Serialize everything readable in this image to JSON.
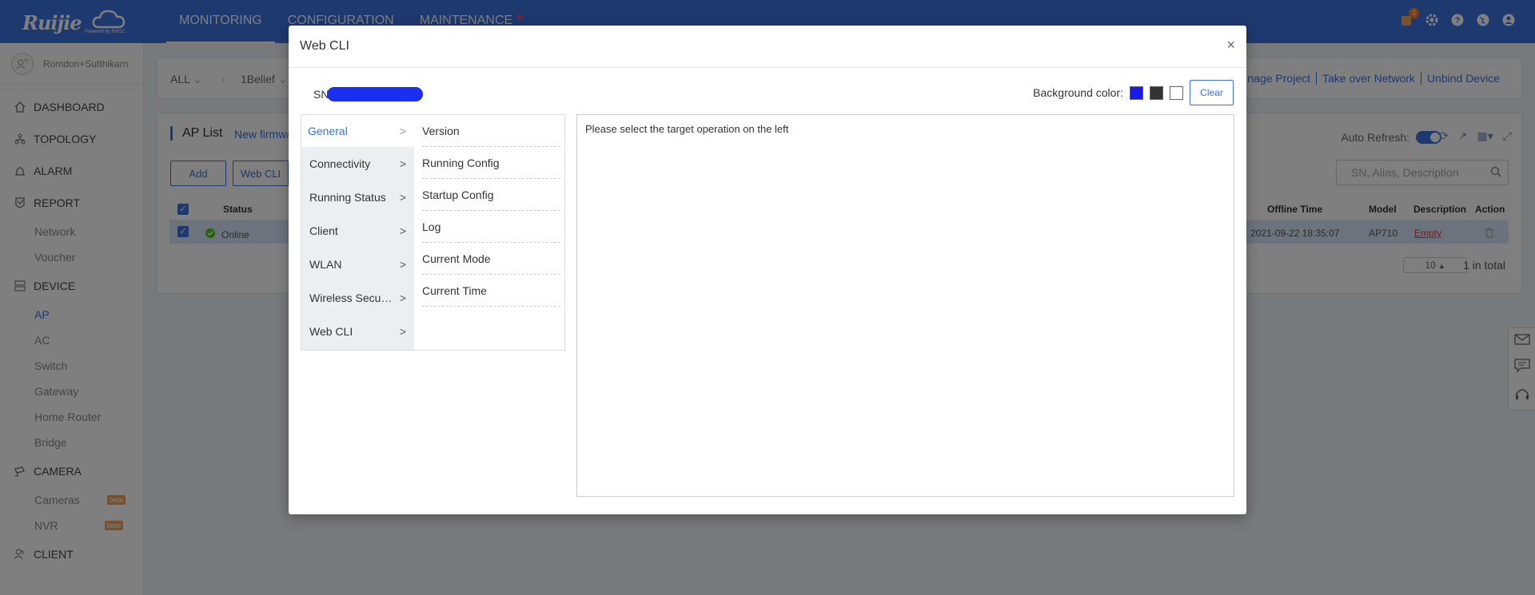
{
  "app": {
    "logo": "Ruijie",
    "logo_sub": "Powered by RACC"
  },
  "nav": {
    "items": [
      {
        "label": "MONITORING"
      },
      {
        "label": "CONFIGURATION"
      },
      {
        "label": "MAINTENANCE"
      }
    ],
    "notification_count": "2"
  },
  "sidebar": {
    "user": "Romdon+Sutthikarn",
    "items": [
      {
        "label": "DASHBOARD",
        "icon": "home-icon"
      },
      {
        "label": "TOPOLOGY",
        "icon": "topology-icon"
      },
      {
        "label": "ALARM",
        "icon": "alarm-icon"
      },
      {
        "label": "REPORT",
        "icon": "report-icon"
      },
      {
        "label": "DEVICE",
        "icon": "device-icon"
      },
      {
        "label": "CAMERA",
        "icon": "camera-icon"
      },
      {
        "label": "CLIENT",
        "icon": "client-icon"
      }
    ],
    "report_sub": [
      "Network",
      "Voucher"
    ],
    "device_sub": [
      "AP",
      "AC",
      "Switch",
      "Gateway",
      "Home Router",
      "Bridge"
    ],
    "camera_sub": [
      "Cameras",
      "NVR"
    ],
    "beta": "beta"
  },
  "breadcrumb": {
    "all": "ALL",
    "project": "1Belief",
    "links": [
      "nage Project",
      "Take over Network",
      "Unbind Device"
    ]
  },
  "ap_list": {
    "title": "AP List",
    "link": "New firmwa",
    "add_label": "Add",
    "webcli_label": "Web CLI",
    "auto_refresh": "Auto Refresh:",
    "search_placeholder": "SN, Alias, Description",
    "columns": {
      "status": "Status",
      "offline": "Offline Time",
      "model": "Model",
      "description": "Description",
      "action": "Action"
    },
    "row": {
      "status": "Online",
      "offline": "2021-09-22 18:35:07",
      "model": "AP710",
      "description": "Empty"
    },
    "page_size": "10",
    "total": "1 in total"
  },
  "modal": {
    "title": "Web CLI",
    "close": "×",
    "sn_label": "SN",
    "bg_label": "Background color:",
    "clear": "Clear",
    "swatches": [
      "#1a1ae6",
      "#333333",
      "#ffffff"
    ],
    "left_menu": [
      {
        "label": "General"
      },
      {
        "label": "Connectivity"
      },
      {
        "label": "Running Status"
      },
      {
        "label": "Client"
      },
      {
        "label": "WLAN"
      },
      {
        "label": "Wireless Security"
      },
      {
        "label": "Web CLI"
      }
    ],
    "right_menu": [
      "Version",
      "Running Config",
      "Startup Config",
      "Log",
      "Current Mode",
      "Current Time"
    ],
    "output_text": "Please select the target operation on the left"
  }
}
